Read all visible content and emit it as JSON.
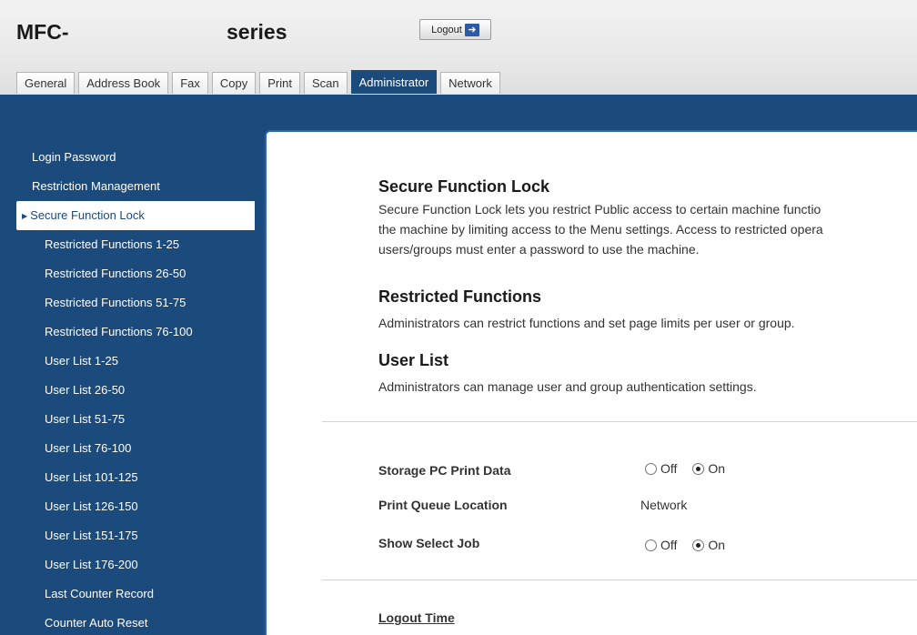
{
  "header": {
    "model_prefix": "MFC-",
    "model_suffix": "series",
    "logout_label": "Logout",
    "logout_icon": "logout-arrow-icon"
  },
  "tabs": [
    {
      "label": "General",
      "active": false
    },
    {
      "label": "Address Book",
      "active": false
    },
    {
      "label": "Fax",
      "active": false
    },
    {
      "label": "Copy",
      "active": false
    },
    {
      "label": "Print",
      "active": false
    },
    {
      "label": "Scan",
      "active": false
    },
    {
      "label": "Administrator",
      "active": true
    },
    {
      "label": "Network",
      "active": false
    }
  ],
  "sidebar": {
    "items": [
      {
        "label": "Login Password",
        "level": 1
      },
      {
        "label": "Restriction Management",
        "level": 1
      },
      {
        "label": "Secure Function Lock",
        "level": 1,
        "active": true
      },
      {
        "label": "Restricted Functions 1-25",
        "level": 2
      },
      {
        "label": "Restricted Functions 26-50",
        "level": 2
      },
      {
        "label": "Restricted Functions 51-75",
        "level": 2
      },
      {
        "label": "Restricted Functions 76-100",
        "level": 2
      },
      {
        "label": "User List 1-25",
        "level": 2
      },
      {
        "label": "User List 26-50",
        "level": 2
      },
      {
        "label": "User List 51-75",
        "level": 2
      },
      {
        "label": "User List 76-100",
        "level": 2
      },
      {
        "label": "User List 101-125",
        "level": 2
      },
      {
        "label": "User List 126-150",
        "level": 2
      },
      {
        "label": "User List 151-175",
        "level": 2
      },
      {
        "label": "User List 176-200",
        "level": 2
      },
      {
        "label": "Last Counter Record",
        "level": 2
      },
      {
        "label": "Counter Auto Reset",
        "level": 2
      }
    ]
  },
  "content": {
    "sfl": {
      "title": "Secure Function Lock",
      "desc_lines": [
        "Secure Function Lock lets you restrict Public access to certain machine functio",
        "the machine by limiting access to the Menu settings. Access to restricted opera",
        "users/groups must enter a password to use the machine."
      ]
    },
    "restricted": {
      "title": "Restricted Functions",
      "desc": "Administrators can restrict functions and set page limits per user or group."
    },
    "userlist": {
      "title": "User List",
      "desc": "Administrators can manage user and group authentication settings."
    },
    "settings": {
      "storage_label": "Storage PC Print Data",
      "queue_label": "Print Queue Location",
      "queue_value": "Network",
      "showjob_label": "Show Select Job",
      "off_label": "Off",
      "on_label": "On",
      "storage_value": "On",
      "showjob_value": "On"
    },
    "logout_time": {
      "title": "Logout Time"
    }
  },
  "colors": {
    "brand_blue": "#1b4a7c",
    "panel_border": "#2e66a8"
  }
}
